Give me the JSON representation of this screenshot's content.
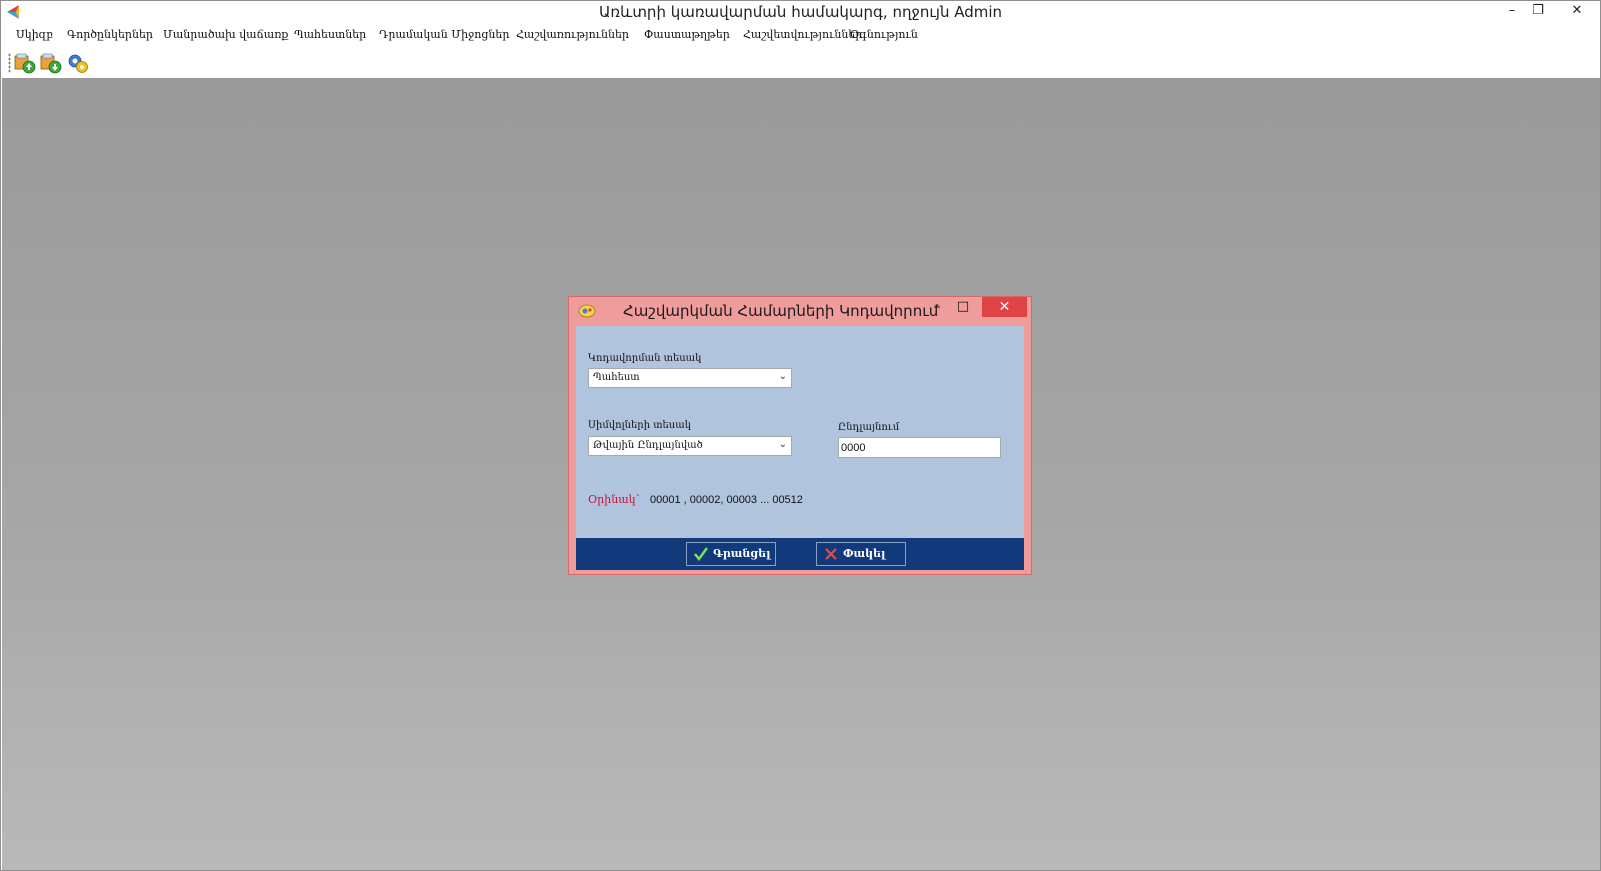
{
  "window": {
    "title": "Առևտրի կառավարման համակարգ, ողջույն Admin",
    "min_glyph": "–",
    "max_glyph": "❐",
    "close_glyph": "✕"
  },
  "menu": {
    "items": [
      "Սկիզբ",
      "Գործընկերներ",
      "Մանրածախ վաճառք",
      "Պահեստներ",
      "Դրամական Միջոցներ",
      "Հաշվառություններ",
      "Փաստաթղթեր",
      "Հաշվետվություններ",
      "Օգնություն"
    ]
  },
  "toolbar": {
    "buttons": [
      "upload-icon",
      "download-icon",
      "settings-icon"
    ]
  },
  "dialog": {
    "title": "Հաշվարկման Համարների Կոդավորում",
    "min_glyph": "–",
    "max_glyph": "□",
    "close_glyph": "✕",
    "coding_type_label": "Կոդավորման տեսակ",
    "coding_type_value": "Պահեստ",
    "symbol_type_label": "Սիմվոլների տեսակ",
    "symbol_type_value": "Թվային Ընդլայնված",
    "extension_label": "Ընդլայնում",
    "extension_value": "0000",
    "example_label": "Օրինակ՝",
    "example_value": "00001 , 00002, 00003 ... 00512",
    "ok_label": "Գրանցել",
    "close_label": "Փակել"
  },
  "colors": {
    "dialog_frame": "#ef9c9c",
    "dialog_body": "#b0c4de",
    "dialog_footer": "#123a7a",
    "close_button": "#e04343",
    "example_label": "#cc1133"
  }
}
